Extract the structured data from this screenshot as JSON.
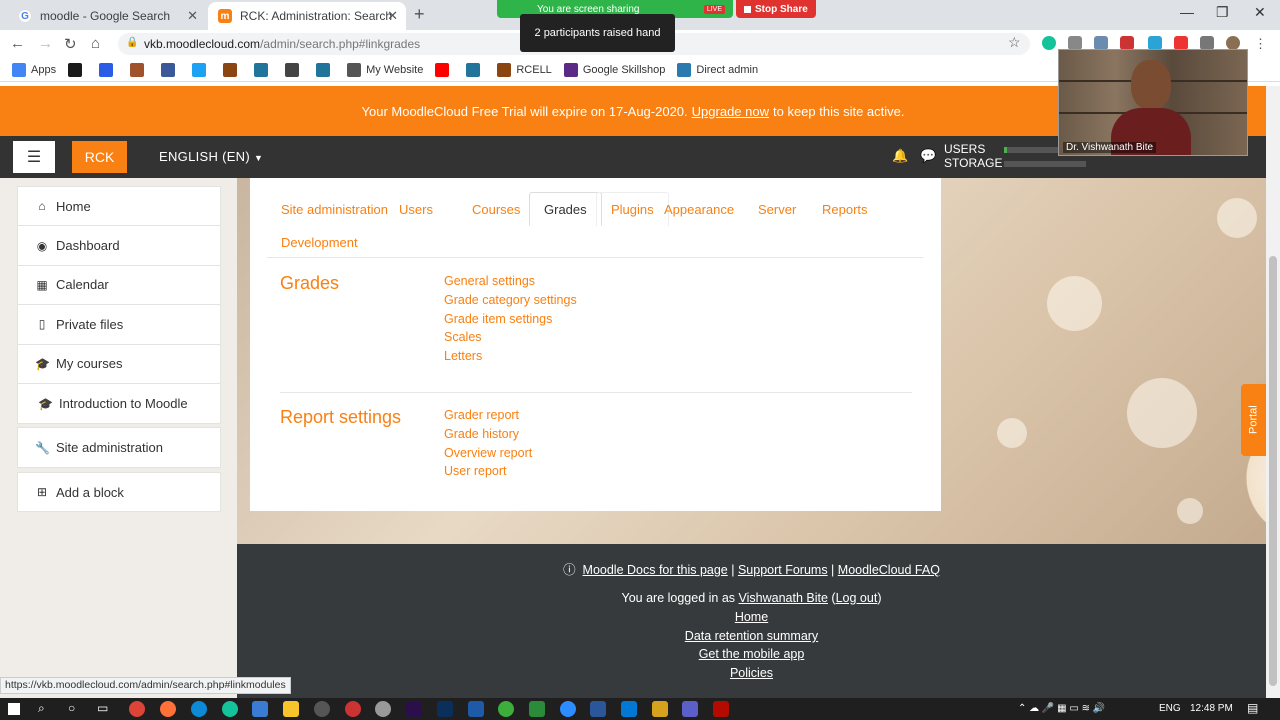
{
  "browser": {
    "tabs": [
      {
        "title": "moodle - Google Search"
      },
      {
        "title": "RCK: Administration: Search"
      }
    ],
    "url_host": "vkb.moodlecloud.com",
    "url_path": "/admin/search.php#linkgrades",
    "screenshare_text": "You are screen sharing",
    "live_label": "LIVE",
    "stop_share_label": "Stop Share",
    "toast": "2 participants raised hand",
    "bookmarks": [
      {
        "label": "Apps",
        "icon": "apps-grid-icon",
        "color": "#4285f4"
      },
      {
        "label": "",
        "icon": "bookmark-icon-1",
        "color": "#1a1a1a"
      },
      {
        "label": "",
        "icon": "bookmark-icon-2",
        "color": "#2b5ce6"
      },
      {
        "label": "",
        "icon": "bookmark-icon-3",
        "color": "#a0522d"
      },
      {
        "label": "",
        "icon": "facebook-icon",
        "color": "#3b5998"
      },
      {
        "label": "",
        "icon": "twitter-icon",
        "color": "#1da1f2"
      },
      {
        "label": "",
        "icon": "bookmark-icon-4",
        "color": "#8b4513"
      },
      {
        "label": "",
        "icon": "wordpress-icon",
        "color": "#21759b"
      },
      {
        "label": "",
        "icon": "bookmark-icon-5",
        "color": "#444"
      },
      {
        "label": "",
        "icon": "wordpress-icon",
        "color": "#21759b"
      },
      {
        "label": "My Website",
        "icon": "person-icon",
        "color": "#555"
      },
      {
        "label": "",
        "icon": "youtube-icon",
        "color": "#ff0000"
      },
      {
        "label": "",
        "icon": "wordpress-icon",
        "color": "#21759b"
      },
      {
        "label": "RCELL",
        "icon": "bookmark-icon-6",
        "color": "#8b4513"
      },
      {
        "label": "Google Skillshop",
        "icon": "bt-icon",
        "color": "#5b2a86"
      },
      {
        "label": "Direct admin",
        "icon": "direct-admin-icon",
        "color": "#2a7ab0"
      }
    ],
    "status_url": "https://vkb.moodlecloud.com/admin/search.php#linkmodules"
  },
  "moodle": {
    "trial_text_before": "Your MoodleCloud Free Trial will expire on 17-Aug-2020.",
    "trial_link": "Upgrade now",
    "trial_text_after": "to keep this site active.",
    "brand": "RCK",
    "language": "ENGLISH (EN)",
    "users_label": "USERS",
    "storage_label": "STORAGE",
    "users_usage_fraction": 0.04,
    "storage_usage_fraction": 0.0,
    "user_name_partial": "Vishwanath Bite",
    "nav_items": [
      {
        "label": "Home",
        "icon": "home-icon",
        "glyph": "⌂"
      },
      {
        "label": "Dashboard",
        "icon": "dashboard-icon",
        "glyph": "◉"
      },
      {
        "label": "Calendar",
        "icon": "calendar-icon",
        "glyph": "▦"
      },
      {
        "label": "Private files",
        "icon": "file-icon",
        "glyph": "▯"
      },
      {
        "label": "My courses",
        "icon": "graduation-cap-icon",
        "glyph": "🎓"
      },
      {
        "label": "Introduction to Moodle",
        "icon": "graduation-cap-icon",
        "glyph": "🎓"
      }
    ],
    "site_admin_label": "Site administration",
    "add_block_label": "Add a block",
    "admin_tabs": [
      "Site administration",
      "Users",
      "Courses",
      "Grades",
      "Plugins",
      "Appearance",
      "Server",
      "Reports",
      "Development"
    ],
    "active_tab": "Grades",
    "sections": [
      {
        "title": "Grades",
        "links": [
          "General settings",
          "Grade category settings",
          "Grade item settings",
          "Scales",
          "Letters"
        ]
      },
      {
        "title": "Report settings",
        "links": [
          "Grader report",
          "Grade history",
          "Overview report",
          "User report"
        ]
      }
    ],
    "footer": {
      "docs": "Moodle Docs for this page",
      "forums": "Support Forums",
      "faq": "MoodleCloud FAQ",
      "logged_in_prefix": "You are logged in as",
      "user": "Vishwanath Bite",
      "logout": "Log out",
      "home": "Home",
      "retention": "Data retention summary",
      "mobile_app": "Get the mobile app",
      "policies": "Policies"
    },
    "portal_label": "Portal"
  },
  "webcam_name": "Dr. Vishwanath Bite",
  "taskbar": {
    "language": "ENG",
    "time": "12:48 PM"
  },
  "colors": {
    "moodle_orange": "#f98012",
    "navbar_dark": "#333333",
    "footer_dark": "#373a3c"
  }
}
